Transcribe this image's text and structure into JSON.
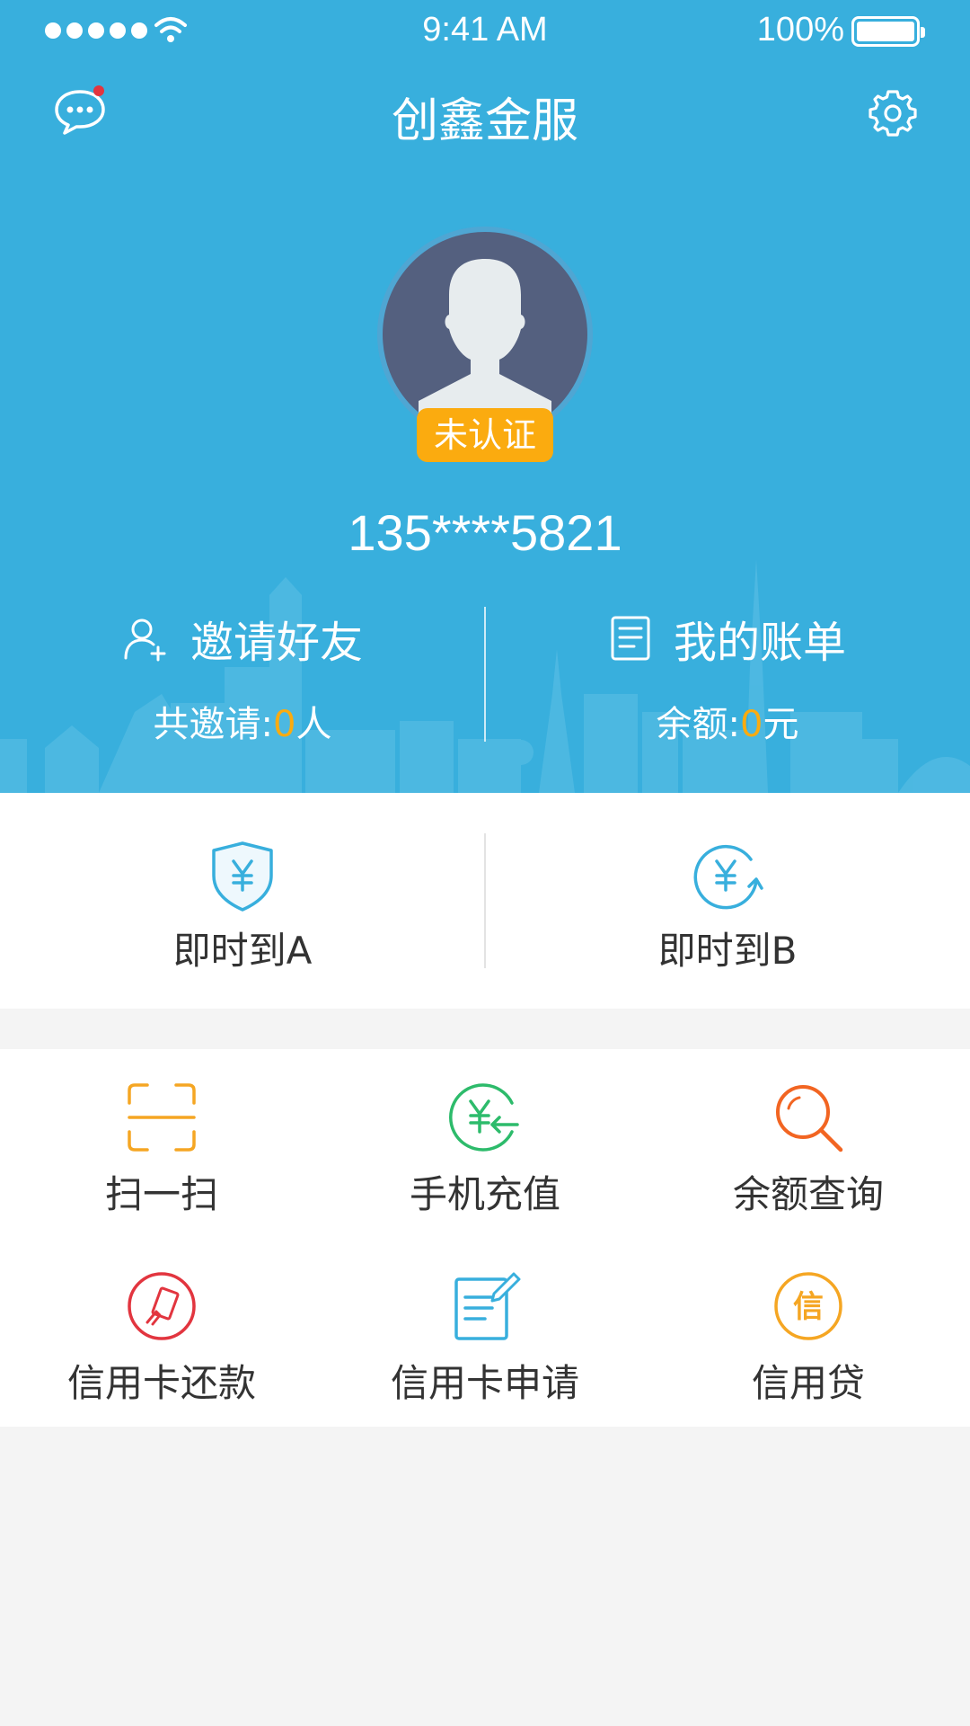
{
  "status_bar": {
    "time": "9:41 AM",
    "battery": "100%"
  },
  "nav": {
    "title": "创鑫金服",
    "message_icon": "chat-bubble-icon",
    "settings_icon": "gear-icon"
  },
  "profile": {
    "badge": "未认证",
    "phone": "135****5821"
  },
  "invite": {
    "title": "邀请好友",
    "count_prefix": "共邀请:",
    "count_value": "0",
    "count_suffix": "人"
  },
  "bill": {
    "title": "我的账单",
    "balance_prefix": "余额:",
    "balance_value": "0",
    "balance_suffix": "元"
  },
  "quick_actions": [
    {
      "label": "即时到A",
      "icon": "shield-yuan-icon"
    },
    {
      "label": "即时到B",
      "icon": "yuan-refresh-icon"
    }
  ],
  "services": [
    {
      "label": "扫一扫",
      "icon": "scan-icon",
      "color": "#f5a623"
    },
    {
      "label": "手机充值",
      "icon": "recharge-icon",
      "color": "#2dbb6b"
    },
    {
      "label": "余额查询",
      "icon": "search-icon",
      "color": "#f26522"
    },
    {
      "label": "信用卡还款",
      "icon": "card-repay-icon",
      "color": "#e2353f"
    },
    {
      "label": "信用卡申请",
      "icon": "apply-form-icon",
      "color": "#38afdd"
    },
    {
      "label": "信用贷",
      "icon": "credit-loan-icon",
      "color": "#f5a623",
      "icon_text": "信"
    }
  ],
  "colors": {
    "primary": "#38afdd",
    "accent": "#fbab0f"
  }
}
